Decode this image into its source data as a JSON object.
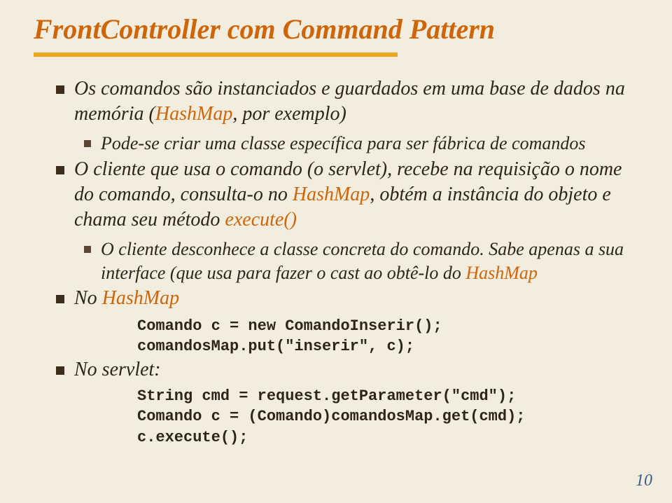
{
  "title": "FrontController com Command Pattern",
  "b1": {
    "pre": "Os comandos são instanciados e guardados em uma base de dados na memória (",
    "hashmap": "HashMap",
    "post": ", por exemplo)"
  },
  "b1a": "Pode-se criar uma classe específica para ser fábrica de comandos",
  "b2": {
    "pre": "O cliente que usa o comando (o servlet), recebe na requisição o nome do comando, consulta-o no ",
    "hashmap": "HashMap",
    "mid": ", obtém a instância do objeto e chama seu método ",
    "exec": "execute()"
  },
  "b2a": {
    "pre": "O cliente desconhece a classe concreta do comando. Sabe apenas a sua interface (que usa para fazer o cast ao obtê-lo do ",
    "hashmap": "HashMap"
  },
  "b3": {
    "pre": "No ",
    "hashmap": "HashMap"
  },
  "code1a": "Comando c = new ComandoInserir();",
  "code1b": "comandosMap.put(\"inserir\", c);",
  "b4": "No servlet:",
  "code2a": "String cmd = request.getParameter(\"cmd\");",
  "code2b": "Comando c = (Comando)comandosMap.get(cmd);",
  "code2c": "c.execute();",
  "page": "10"
}
